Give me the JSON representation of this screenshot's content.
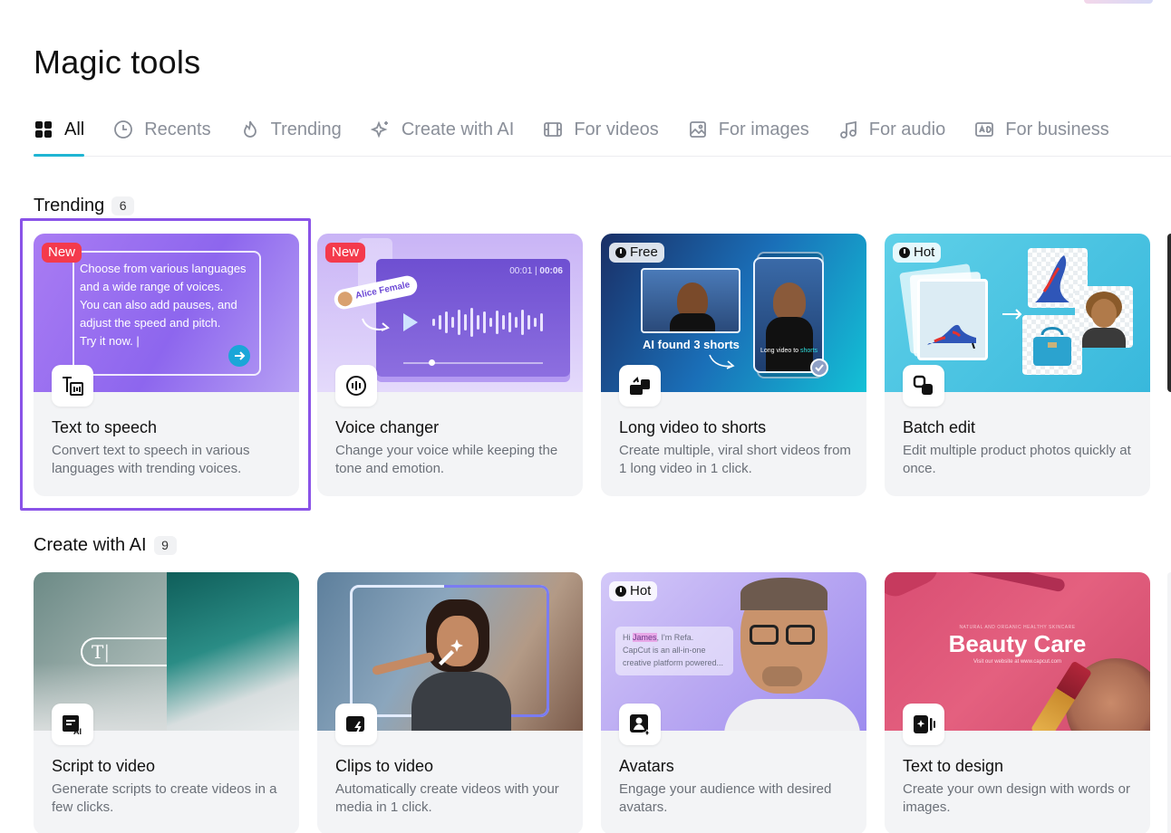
{
  "page": {
    "title": "Magic tools"
  },
  "tabs": [
    {
      "label": "All",
      "icon": "grid-icon"
    },
    {
      "label": "Recents",
      "icon": "clock-icon"
    },
    {
      "label": "Trending",
      "icon": "flame-icon"
    },
    {
      "label": "Create with AI",
      "icon": "sparkle-icon"
    },
    {
      "label": "For videos",
      "icon": "film-icon"
    },
    {
      "label": "For images",
      "icon": "image-icon"
    },
    {
      "label": "For audio",
      "icon": "music-note-icon"
    },
    {
      "label": "For business",
      "icon": "ad-icon"
    }
  ],
  "sections": [
    {
      "title": "Trending",
      "count": "6",
      "cards": [
        {
          "title": "Text to speech",
          "desc": "Convert text to speech in various languages with trending voices.",
          "badge": "New",
          "preview_text": [
            "Choose from various languages",
            "and a wide range of voices.",
            "You can also add pauses, and",
            "adjust the speed and pitch.",
            "Try it now."
          ]
        },
        {
          "title": "Voice changer",
          "desc": "Change your voice while keeping the tone and emotion.",
          "badge": "New",
          "preview_voice": "Alice Female",
          "preview_time": "00:01",
          "preview_duration": "00:06"
        },
        {
          "title": "Long video to shorts",
          "desc": "Create multiple, viral short videos from 1 long video in 1 click.",
          "badge": "Free",
          "preview_text": "AI found 3 shorts",
          "preview_small": "Long video to",
          "preview_small_accent": "shorts"
        },
        {
          "title": "Batch edit",
          "desc": "Edit multiple product photos quickly at once.",
          "badge": "Hot"
        }
      ]
    },
    {
      "title": "Create with AI",
      "count": "9",
      "cards": [
        {
          "title": "Script to video",
          "desc": "Generate scripts to create videos in a few clicks.",
          "preview_text": "T"
        },
        {
          "title": "Clips to video",
          "desc": "Automatically create videos with your media in 1 click."
        },
        {
          "title": "Avatars",
          "desc": "Engage your audience with desired avatars.",
          "badge": "Hot",
          "preview_lines": [
            "Hi",
            "James",
            ", I'm Refa.",
            "CapCut is an all-in-one",
            "creative platform powered..."
          ]
        },
        {
          "title": "Text to design",
          "desc": "Create your own design with words or images.",
          "preview_title": "Beauty Care",
          "preview_sub": "Visit our website at www.capcut.com",
          "preview_top": "NATURAL AND ORGANIC HEALTHY SKINCARE"
        }
      ]
    }
  ],
  "colors": {
    "accent_tab": "#1fb5d3",
    "selection": "#8a53e8",
    "new_badge": "#f43a4c"
  }
}
